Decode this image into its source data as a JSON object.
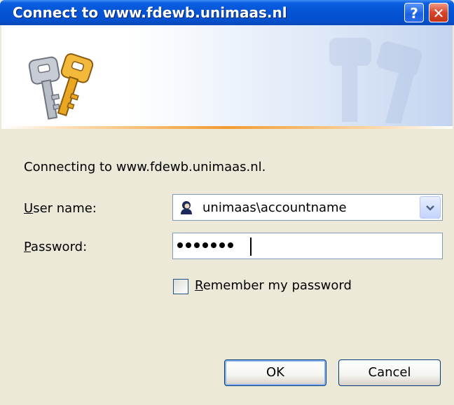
{
  "window": {
    "title": "Connect to www.fdewb.unimaas.nl",
    "help_label": "?",
    "close_label": "✕"
  },
  "banner": {
    "icon": "keys-icon",
    "watermark_icon": "keys-watermark-icon"
  },
  "body": {
    "connecting_text": "Connecting to www.fdewb.unimaas.nl."
  },
  "form": {
    "user_label": "User name:",
    "user_value": "unimaas\\accountname",
    "user_icon": "user-icon",
    "password_label": "Password:",
    "password_mask_count": 7,
    "remember_label": "Remember my password",
    "remember_checked": false
  },
  "buttons": {
    "ok": "OK",
    "cancel": "Cancel"
  },
  "colors": {
    "titlebar": "#0454d6",
    "dialog_bg": "#ece9d8",
    "accent_line": "#f39a30",
    "close": "#d8442a"
  }
}
